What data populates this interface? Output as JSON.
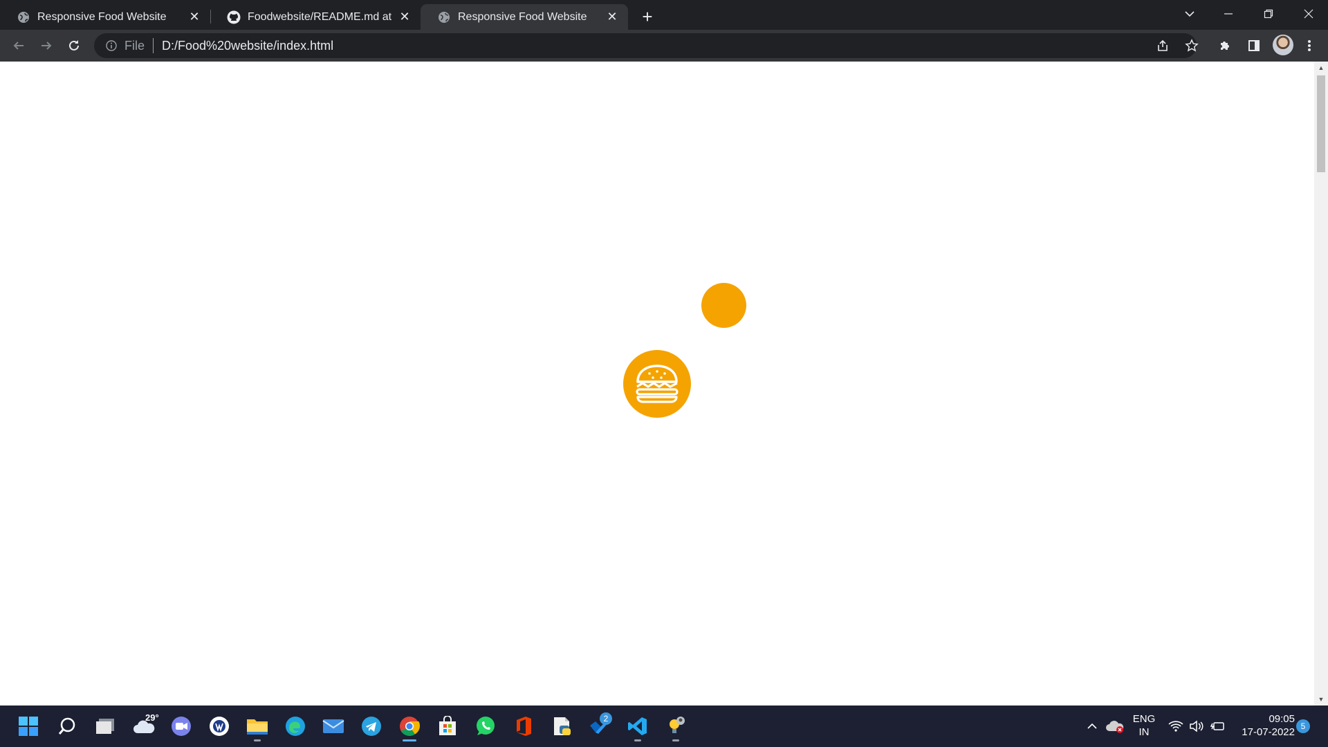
{
  "browser": {
    "tabs": [
      {
        "title": "Responsive Food Website",
        "favicon": "globe-icon",
        "active": false
      },
      {
        "title": "Foodwebsite/README.md at main",
        "favicon": "github-icon",
        "active": false
      },
      {
        "title": "Responsive Food Website",
        "favicon": "globe-icon",
        "active": true
      }
    ],
    "address": {
      "scheme": "File",
      "url": "D:/Food%20website/index.html"
    }
  },
  "page": {
    "accent_color": "#f5a300",
    "loader_icon": "burger-icon"
  },
  "taskbar": {
    "weather_temp": "29°",
    "apps": [
      {
        "name": "start"
      },
      {
        "name": "search"
      },
      {
        "name": "task-view"
      },
      {
        "name": "weather"
      },
      {
        "name": "teams-chat"
      },
      {
        "name": "whiteboard"
      },
      {
        "name": "file-explorer"
      },
      {
        "name": "edge"
      },
      {
        "name": "mail"
      },
      {
        "name": "telegram"
      },
      {
        "name": "chrome"
      },
      {
        "name": "store"
      },
      {
        "name": "whatsapp"
      },
      {
        "name": "office"
      },
      {
        "name": "python-editor"
      },
      {
        "name": "power-automate"
      },
      {
        "name": "vscode"
      },
      {
        "name": "tips"
      }
    ],
    "power_automate_badge": "2",
    "tray": {
      "language": "ENG",
      "region": "IN",
      "time": "09:05",
      "date": "17-07-2022",
      "notification_count": "5"
    }
  }
}
